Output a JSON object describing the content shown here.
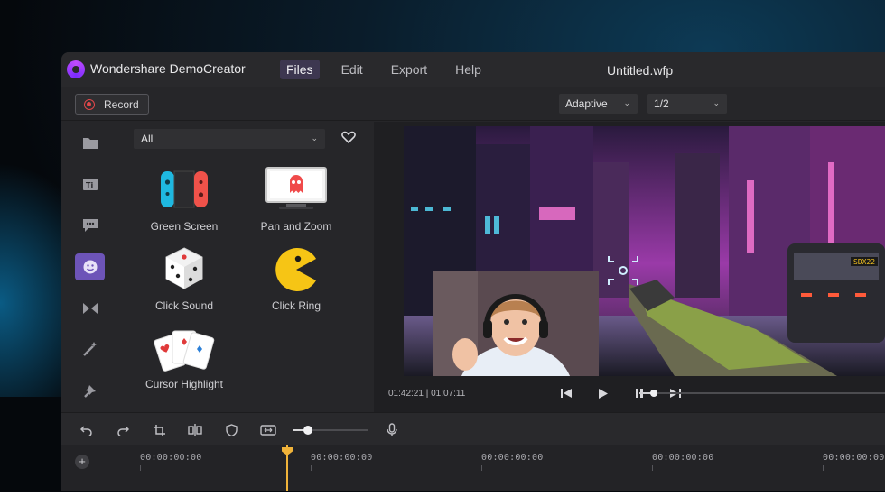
{
  "app": {
    "name": "Wondershare DemoCreator",
    "document_title": "Untitled.wfp"
  },
  "menu": {
    "items": [
      {
        "label": "Files",
        "active": true
      },
      {
        "label": "Edit",
        "active": false
      },
      {
        "label": "Export",
        "active": false
      },
      {
        "label": "Help",
        "active": false
      }
    ]
  },
  "toolbar": {
    "record_label": "Record",
    "quality_select": "Adaptive",
    "ratio_select": "1/2"
  },
  "rail": {
    "items": [
      {
        "icon": "folder-icon",
        "active": false
      },
      {
        "icon": "text-title-icon",
        "active": false
      },
      {
        "icon": "caption-bubble-icon",
        "active": false
      },
      {
        "icon": "effects-face-icon",
        "active": true
      },
      {
        "icon": "transition-icon",
        "active": false
      },
      {
        "icon": "magic-wand-icon",
        "active": false
      },
      {
        "icon": "cursor-pin-icon",
        "active": false
      }
    ]
  },
  "library": {
    "filter_value": "All",
    "tiles": [
      {
        "label": "Green Screen",
        "icon": "game-controller-icon"
      },
      {
        "label": "Pan and Zoom",
        "icon": "monitor-ghost-icon"
      },
      {
        "label": "Click Sound",
        "icon": "dice-icon"
      },
      {
        "label": "Click Ring",
        "icon": "pacman-icon"
      },
      {
        "label": "Cursor Highlight",
        "icon": "playing-cards-icon"
      }
    ]
  },
  "preview": {
    "timecode": "01:42:21 | 01:07:11",
    "seek_progress": 0.06,
    "scene_sign": "SDX22"
  },
  "timeline": {
    "zoom_level": 0.2,
    "ticks": [
      "00:00:00:00",
      "00:00:00:00",
      "00:00:00:00",
      "00:00:00:00",
      "00:00:00:00"
    ]
  },
  "colors": {
    "accent": "#6d54b8",
    "record_red": "#e0474a",
    "playhead": "#f0b33a",
    "app_bg": "#262629"
  }
}
